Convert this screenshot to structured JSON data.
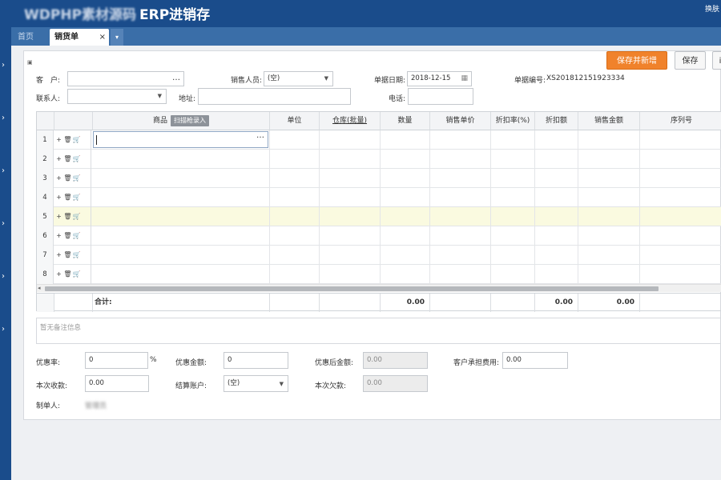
{
  "header": {
    "brand_blurred": "WDPHP素材源码",
    "brand": "ERP进销存",
    "switch": "换肤"
  },
  "tabs": {
    "home": "首页",
    "active": "销货单",
    "close": "×",
    "menu": "▾"
  },
  "toolbar": {
    "save_new": "保存并新增",
    "save": "保存",
    "more": "i"
  },
  "form": {
    "customer_label": "客　户:",
    "customer_value": "",
    "salesman_label": "销售人员:",
    "salesman_value": "(空)",
    "date_label": "单据日期:",
    "date_value": "2018-12-15",
    "docno_label": "单据编号:",
    "docno_value": "XS201812151923334",
    "contact_label": "联系人:",
    "contact_value": "",
    "address_label": "地址:",
    "address_value": "",
    "phone_label": "电话:",
    "phone_value": ""
  },
  "grid": {
    "columns": [
      "商品",
      "单位",
      "仓库(批量)",
      "数量",
      "销售单价",
      "折扣率(%)",
      "折扣额",
      "销售金额",
      "序列号"
    ],
    "scan_label": "扫描枪录入",
    "rows": [
      "1",
      "2",
      "3",
      "4",
      "5",
      "6",
      "7",
      "8"
    ],
    "ops": [
      "+",
      "🗑",
      "🛒"
    ],
    "total_label": "合计:",
    "total_qty": "0.00",
    "total_discount": "0.00",
    "total_amount": "0.00"
  },
  "remark": {
    "placeholder": "暂无备注信息"
  },
  "footer": {
    "discount_rate_label": "优惠率:",
    "discount_rate_value": "0",
    "percent": "%",
    "discount_amount_label": "优惠金额:",
    "discount_amount_value": "0",
    "after_discount_label": "优惠后金额:",
    "after_discount_value": "0.00",
    "customer_fee_label": "客户承担费用:",
    "customer_fee_value": "0.00",
    "received_label": "本次收款:",
    "received_value": "0.00",
    "account_label": "结算账户:",
    "account_value": "(空)",
    "debt_label": "本次欠款:",
    "debt_value": "0.00",
    "maker_label": "制单人:",
    "maker_value": "管理员"
  }
}
